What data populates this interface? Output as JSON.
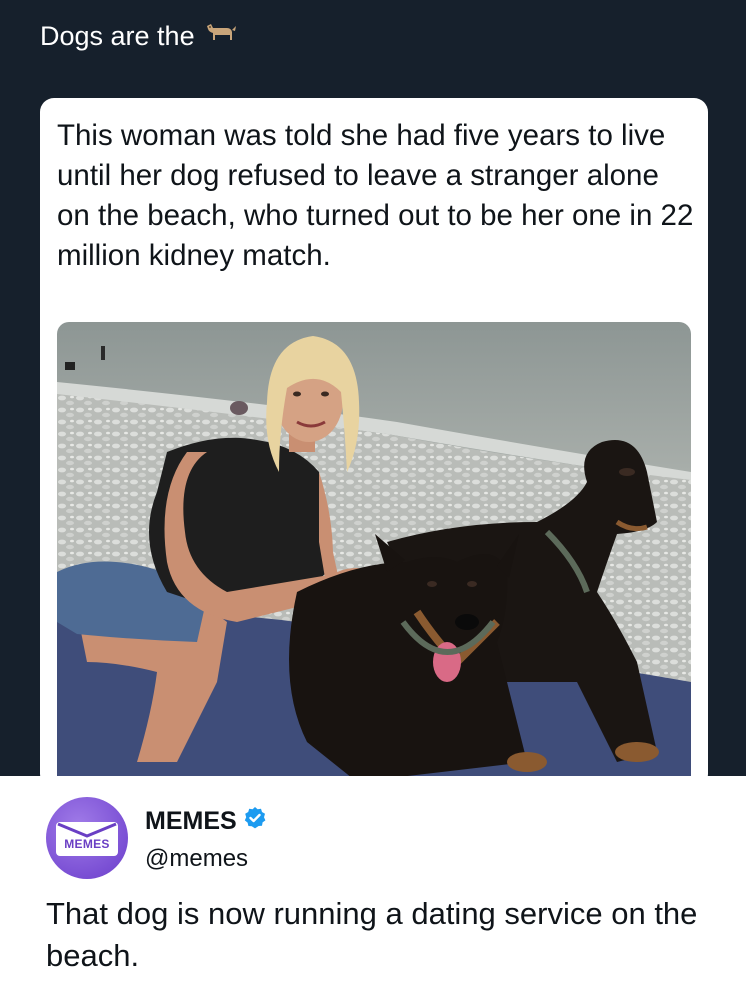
{
  "header": {
    "caption": "Dogs are the",
    "caption_icon": "dog-emoji-icon"
  },
  "quoted_tweet": {
    "text": "This woman was told she had five years to live until her dog refused to leave a stranger alone on the beach, who turned out to be her one in 22 million kidney match.",
    "image": "photo-woman-with-two-dobermans-on-pebble-beach"
  },
  "reply": {
    "display_name": "MEMES",
    "verified_icon": "verified-badge-icon",
    "handle": "@memes",
    "avatar_label": "MEMES",
    "text": "That dog is now running a dating service on the beach."
  },
  "colors": {
    "dark_background": "#16202c",
    "card_background": "#ffffff",
    "text": "#0f1419",
    "avatar_purple": "#7a4fd4",
    "verified_blue": "#1d9bf0"
  }
}
